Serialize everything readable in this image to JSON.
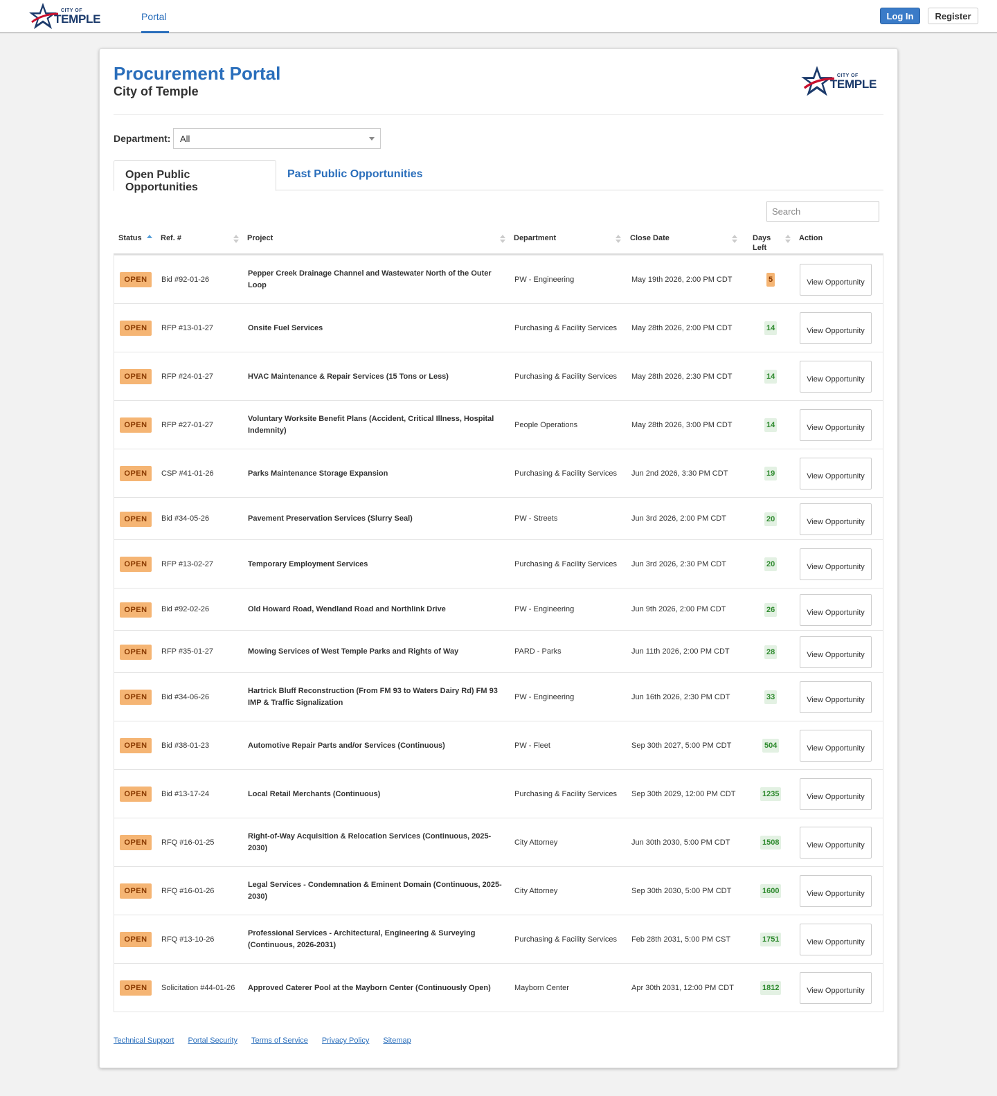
{
  "nav": {
    "logo_small": "CITY OF",
    "logo_big": "TEMPLE",
    "portal_tab": "Portal",
    "login": "Log In",
    "register": "Register"
  },
  "header": {
    "title": "Procurement Portal",
    "subtitle": "City of Temple"
  },
  "filter": {
    "label": "Department:",
    "value": "All"
  },
  "tabs": {
    "open": "Open Public Opportunities",
    "past": "Past Public Opportunities"
  },
  "search": {
    "placeholder": "Search"
  },
  "columns": {
    "status": "Status",
    "ref": "Ref. #",
    "project": "Project",
    "department": "Department",
    "close_date": "Close Date",
    "days_left_1": "Days",
    "days_left_2": "Left",
    "action": "Action"
  },
  "rows": [
    {
      "status": "OPEN",
      "ref": "Bid #92-01-26",
      "project": "Pepper Creek Drainage Channel and Wastewater North of the Outer Loop",
      "department": "PW - Engineering",
      "close": "May 19th 2026, 2:00 PM CDT",
      "days": "5",
      "days_style": "orange",
      "action": "View Opportunity"
    },
    {
      "status": "OPEN",
      "ref": "RFP #13-01-27",
      "project": "Onsite Fuel Services",
      "department": "Purchasing & Facility Services",
      "close": "May 28th 2026, 2:00 PM CDT",
      "days": "14",
      "days_style": "green",
      "action": "View Opportunity"
    },
    {
      "status": "OPEN",
      "ref": "RFP #24-01-27",
      "project": "HVAC Maintenance & Repair Services (15 Tons or Less)",
      "department": "Purchasing & Facility Services",
      "close": "May 28th 2026, 2:30 PM CDT",
      "days": "14",
      "days_style": "green",
      "action": "View Opportunity"
    },
    {
      "status": "OPEN",
      "ref": "RFP #27-01-27",
      "project": "Voluntary Worksite Benefit Plans (Accident, Critical Illness, Hospital Indemnity)",
      "department": "People Operations",
      "close": "May 28th 2026, 3:00 PM CDT",
      "days": "14",
      "days_style": "green",
      "action": "View Opportunity"
    },
    {
      "status": "OPEN",
      "ref": "CSP #41-01-26",
      "project": "Parks Maintenance Storage Expansion",
      "department": "Purchasing & Facility Services",
      "close": "Jun 2nd 2026, 3:30 PM CDT",
      "days": "19",
      "days_style": "green",
      "action": "View Opportunity"
    },
    {
      "status": "OPEN",
      "ref": "Bid #34-05-26",
      "project": "Pavement Preservation Services (Slurry Seal)",
      "department": "PW - Streets",
      "close": "Jun 3rd 2026, 2:00 PM CDT",
      "days": "20",
      "days_style": "green",
      "action": "View Opportunity"
    },
    {
      "status": "OPEN",
      "ref": "RFP #13-02-27",
      "project": "Temporary Employment Services",
      "department": "Purchasing & Facility Services",
      "close": "Jun 3rd 2026, 2:30 PM CDT",
      "days": "20",
      "days_style": "green",
      "action": "View Opportunity"
    },
    {
      "status": "OPEN",
      "ref": "Bid #92-02-26",
      "project": "Old Howard Road, Wendland Road and Northlink Drive",
      "department": "PW - Engineering",
      "close": "Jun 9th 2026, 2:00 PM CDT",
      "days": "26",
      "days_style": "green",
      "action": "View Opportunity"
    },
    {
      "status": "OPEN",
      "ref": "RFP #35-01-27",
      "project": "Mowing Services of West Temple Parks and Rights of Way",
      "department": "PARD - Parks",
      "close": "Jun 11th 2026, 2:00 PM CDT",
      "days": "28",
      "days_style": "green",
      "action": "View Opportunity"
    },
    {
      "status": "OPEN",
      "ref": "Bid #34-06-26",
      "project": "Hartrick Bluff Reconstruction (From FM 93 to Waters Dairy Rd) FM 93 IMP & Traffic Signalization",
      "department": "PW - Engineering",
      "close": "Jun 16th 2026, 2:30 PM CDT",
      "days": "33",
      "days_style": "green",
      "action": "View Opportunity"
    },
    {
      "status": "OPEN",
      "ref": "Bid #38-01-23",
      "project": "Automotive Repair Parts and/or Services (Continuous)",
      "department": "PW - Fleet",
      "close": "Sep 30th 2027, 5:00 PM CDT",
      "days": "504",
      "days_style": "green",
      "action": "View Opportunity"
    },
    {
      "status": "OPEN",
      "ref": "Bid #13-17-24",
      "project": "Local Retail Merchants (Continuous)",
      "department": "Purchasing & Facility Services",
      "close": "Sep 30th 2029, 12:00 PM CDT",
      "days": "1235",
      "days_style": "green",
      "action": "View Opportunity"
    },
    {
      "status": "OPEN",
      "ref": "RFQ #16-01-25",
      "project": "Right-of-Way Acquisition & Relocation Services (Continuous, 2025-2030)",
      "department": "City Attorney",
      "close": "Jun 30th 2030, 5:00 PM CDT",
      "days": "1508",
      "days_style": "green",
      "action": "View Opportunity"
    },
    {
      "status": "OPEN",
      "ref": "RFQ #16-01-26",
      "project": "Legal Services - Condemnation & Eminent Domain (Continuous, 2025-2030)",
      "department": "City Attorney",
      "close": "Sep 30th 2030, 5:00 PM CDT",
      "days": "1600",
      "days_style": "green",
      "action": "View Opportunity"
    },
    {
      "status": "OPEN",
      "ref": "RFQ #13-10-26",
      "project": "Professional Services - Architectural, Engineering & Surveying (Continuous, 2026-2031)",
      "department": "Purchasing & Facility Services",
      "close": "Feb 28th 2031, 5:00 PM CST",
      "days": "1751",
      "days_style": "green",
      "action": "View Opportunity"
    },
    {
      "status": "OPEN",
      "ref": "Solicitation #44-01-26",
      "project": "Approved Caterer Pool at the Mayborn Center (Continuously Open)",
      "department": "Mayborn Center",
      "close": "Apr 30th 2031, 12:00 PM CDT",
      "days": "1812",
      "days_style": "green",
      "action": "View Opportunity"
    }
  ],
  "footer": {
    "links": [
      "Technical Support",
      "Portal Security",
      "Terms of Service",
      "Privacy Policy",
      "Sitemap"
    ]
  },
  "colors": {
    "accent": "#2a6ebb",
    "status_open": "#f5b574",
    "days_green": "#e3f1e3"
  }
}
